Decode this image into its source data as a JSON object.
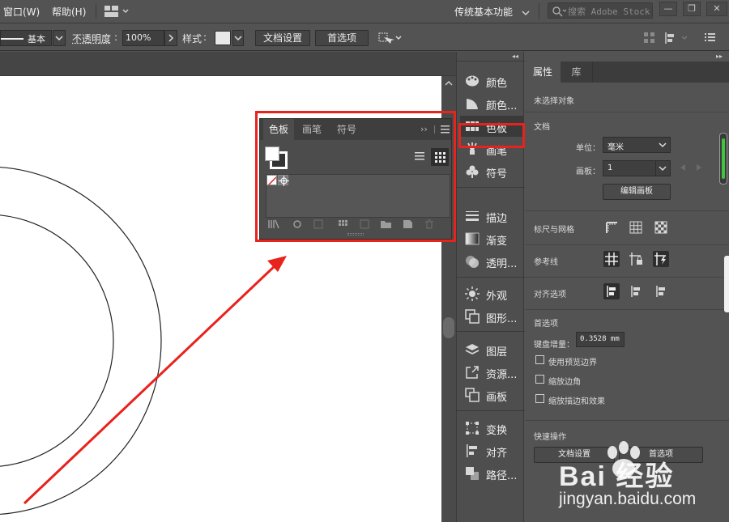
{
  "menubar": {
    "window": "窗口(W)",
    "help": "帮助(H)",
    "workspace": "传统基本功能",
    "search_placeholder": "搜索 Adobe Stock"
  },
  "controlbar": {
    "stroke_profile": "基本",
    "opacity_label": "不透明度",
    "opacity_value": "100%",
    "style_label": "样式",
    "doc_setup": "文档设置",
    "preferences": "首选项"
  },
  "swatches_panel": {
    "tabs": [
      "色板",
      "画笔",
      "符号"
    ],
    "active_tab": "色板"
  },
  "dock": {
    "collapse_glyph": "◂◂",
    "groups": [
      [
        {
          "label": "颜色",
          "icon": "palette-icon"
        },
        {
          "label": "颜色...",
          "icon": "color-guide-icon"
        },
        {
          "label": "色板",
          "icon": "swatches-icon"
        },
        {
          "label": "画笔",
          "icon": "brush-icon"
        },
        {
          "label": "符号",
          "icon": "club-icon"
        }
      ],
      [
        {
          "label": "描边",
          "icon": "stroke-icon"
        },
        {
          "label": "渐变",
          "icon": "gradient-icon"
        },
        {
          "label": "透明...",
          "icon": "transparency-icon"
        }
      ],
      [
        {
          "label": "外观",
          "icon": "appearance-icon"
        },
        {
          "label": "图形...",
          "icon": "graphic-styles-icon"
        }
      ],
      [
        {
          "label": "图层",
          "icon": "layers-icon"
        },
        {
          "label": "资源...",
          "icon": "asset-export-icon"
        },
        {
          "label": "画板",
          "icon": "artboards-icon"
        }
      ],
      [
        {
          "label": "变换",
          "icon": "transform-icon"
        },
        {
          "label": "对齐",
          "icon": "align-icon"
        },
        {
          "label": "路径...",
          "icon": "pathfinder-icon"
        }
      ]
    ],
    "highlighted": "色板"
  },
  "properties": {
    "tabs": [
      "属性",
      "库"
    ],
    "active_tab": "属性",
    "no_selection": "未选择对象",
    "document_heading": "文档",
    "units_label": "单位：",
    "units_value": "毫米",
    "artboard_label": "画板：",
    "artboard_value": "1",
    "edit_artboards": "编辑画板",
    "rulers_grids": "标尺与网格",
    "guides": "参考线",
    "align_options": "对齐选项",
    "prefs_heading": "首选项",
    "keyboard_increment_label": "键盘增量：",
    "keyboard_increment_value": "0.3528 mm",
    "use_preview_bounds": "使用预览边界",
    "scale_corners": "缩放边角",
    "scale_strokes_effects": "缩放描边和效果",
    "quick_actions": "快速操作",
    "doc_setup_btn": "文档设置",
    "prefs_btn": "首选项"
  },
  "watermark": {
    "brand": "Bai 经验",
    "url": "jingyan.baidu.com"
  },
  "colors": {
    "annotation_red": "#e8221c"
  }
}
